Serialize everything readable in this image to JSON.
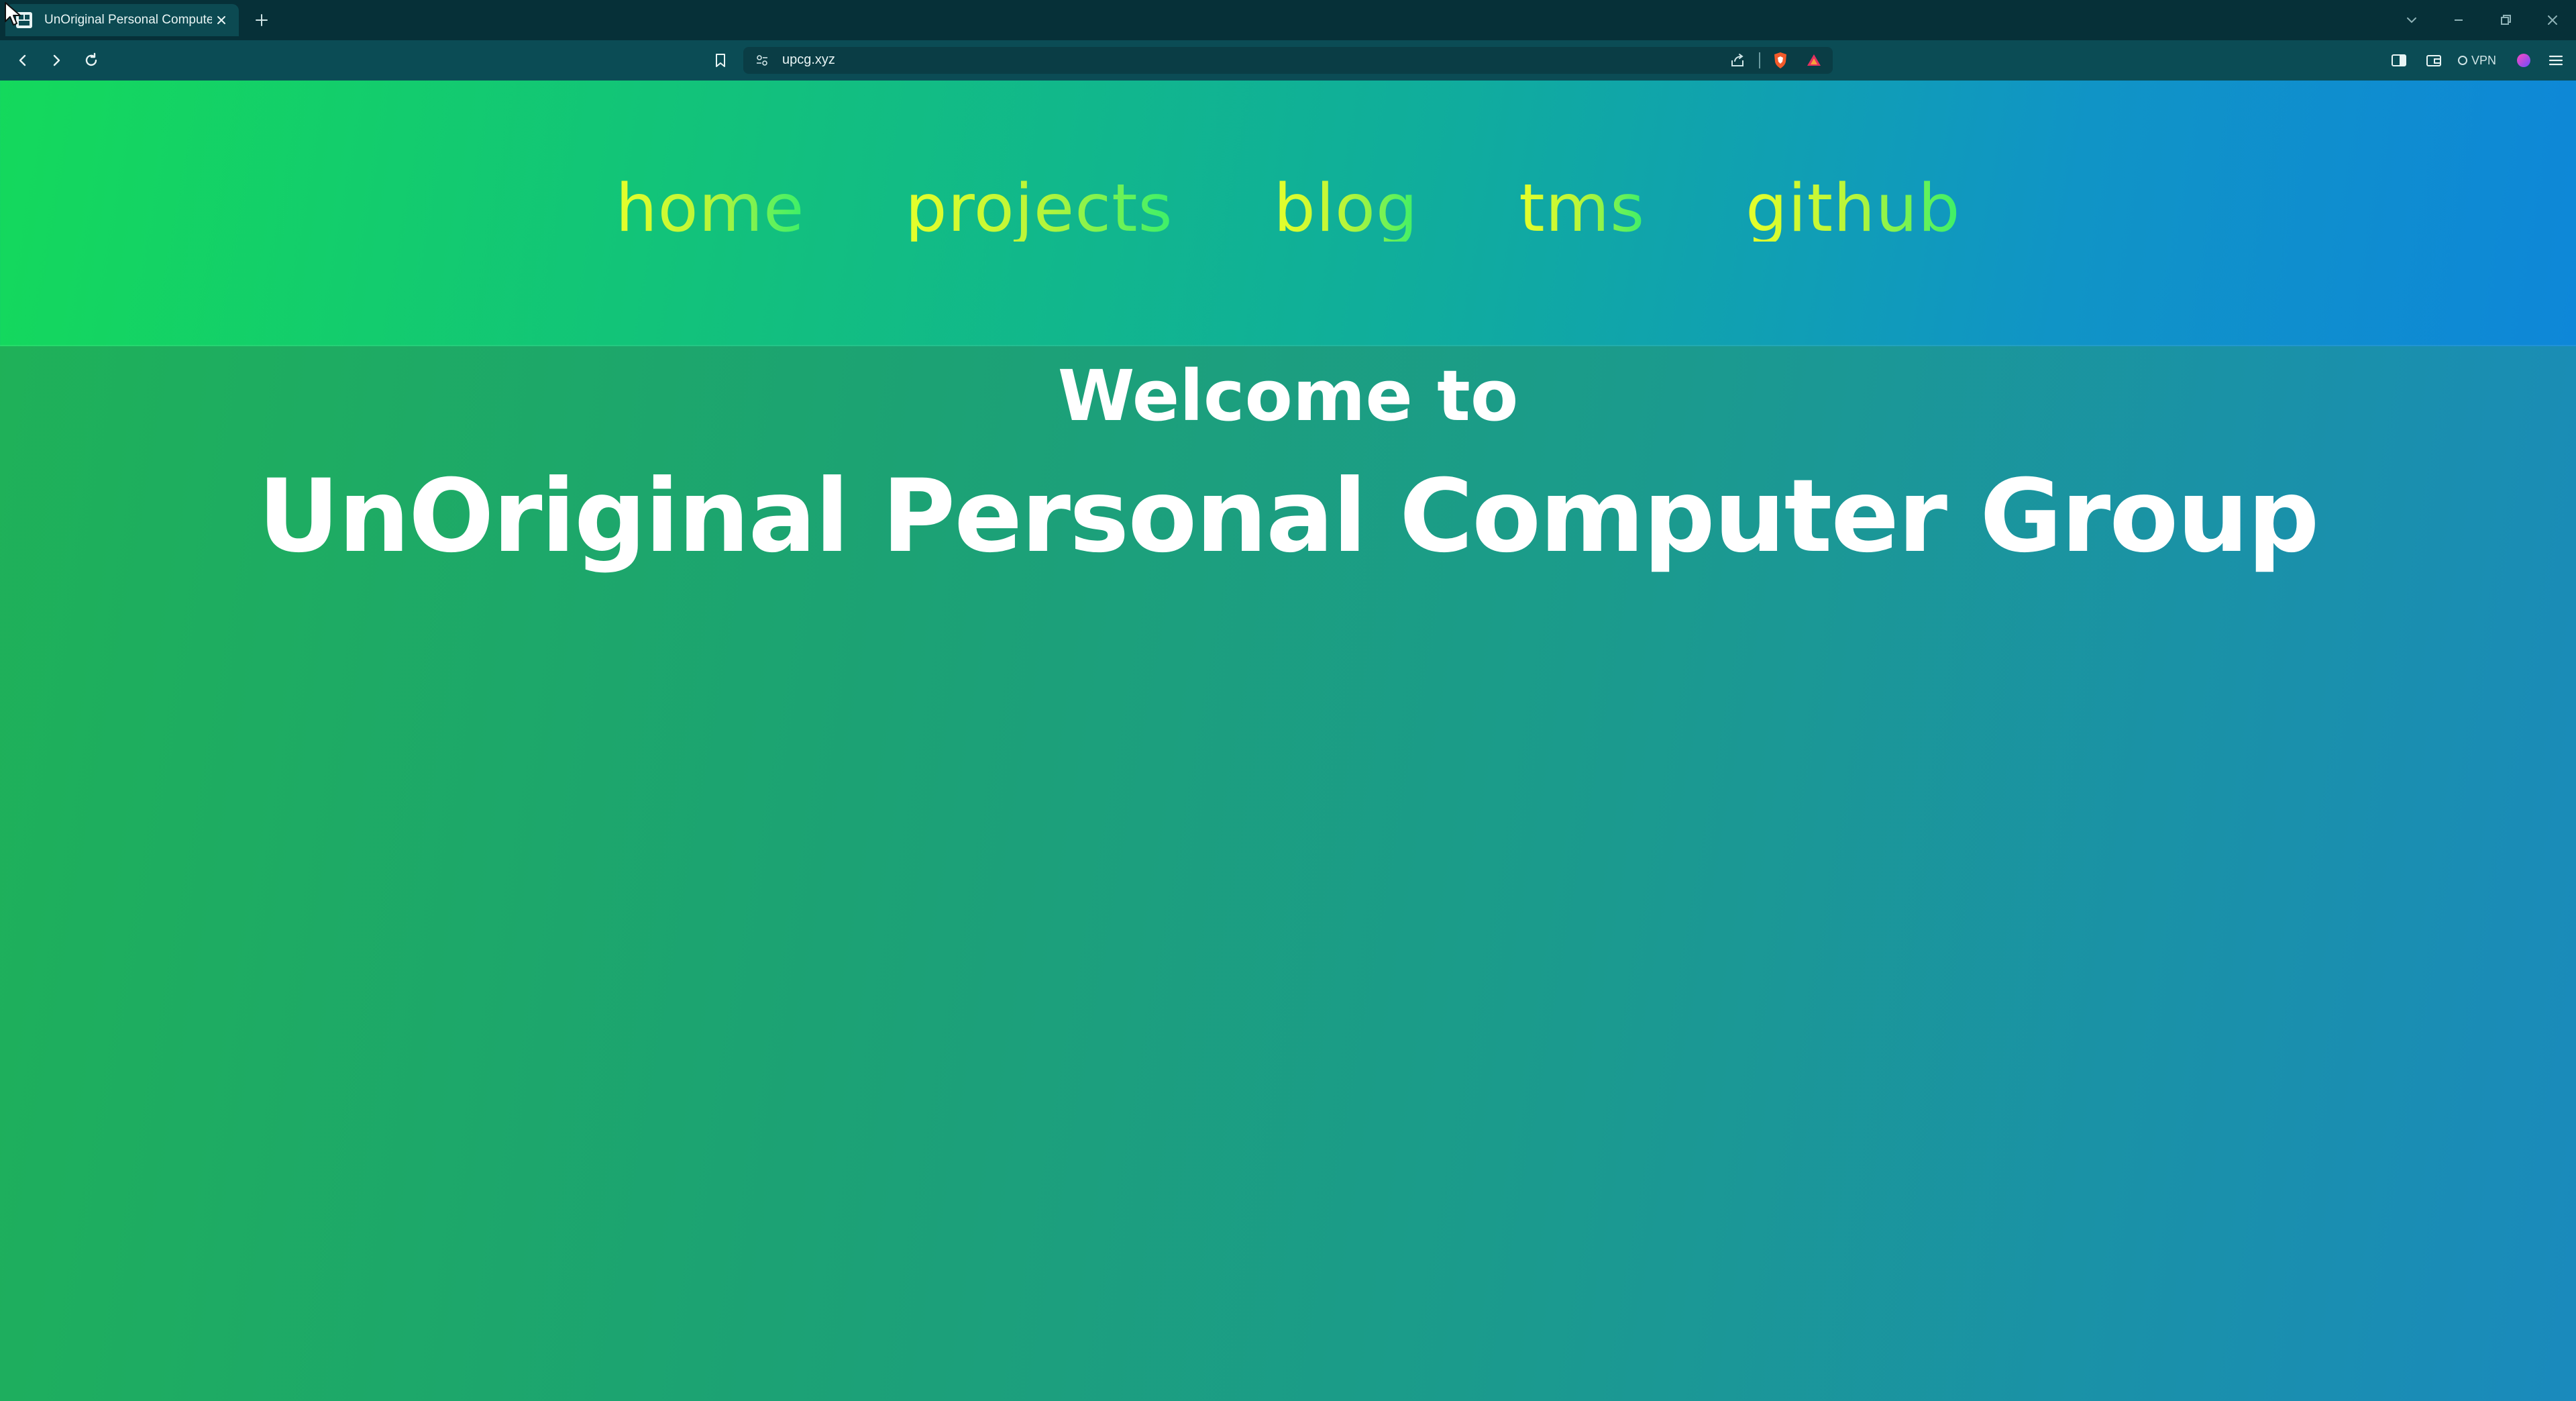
{
  "browser": {
    "tab": {
      "title": "UnOriginal Personal Computer",
      "close_icon": "close-icon",
      "favicon": "upcg-favicon"
    },
    "new_tab_icon": "plus-icon",
    "window_controls": [
      "chevron-down-icon",
      "minimize-icon",
      "restore-icon",
      "close-icon"
    ],
    "toolbar": {
      "back_icon": "back-arrow-icon",
      "forward_icon": "forward-arrow-icon",
      "reload_icon": "reload-icon",
      "bookmark_icon": "bookmark-icon",
      "url": "upcg.xyz",
      "site_info_icon": "site-settings-icon",
      "share_icon": "share-icon",
      "shields_icon": "brave-shields-icon",
      "rewards_icon": "brave-rewards-icon",
      "sidebar_icon": "sidebar-icon",
      "wallet_icon": "wallet-icon",
      "vpn_label": "VPN",
      "leo_icon": "leo-ai-icon",
      "menu_icon": "hamburger-menu-icon"
    }
  },
  "site": {
    "nav": [
      {
        "label": "home"
      },
      {
        "label": "projects"
      },
      {
        "label": "blog"
      },
      {
        "label": "tms"
      },
      {
        "label": "github"
      }
    ],
    "welcome": "Welcome to",
    "title": "UnOriginal Personal Computer Group"
  },
  "colors": {
    "tabbar_bg": "#063038",
    "toolbar_bg": "#0b4c55",
    "header_gradient_start": "#14d95c",
    "header_gradient_end": "#0e87d8",
    "page_gradient_start": "#1fb257",
    "page_gradient_end": "#1a8abd",
    "nav_gradient_start": "#e6ff2a",
    "nav_gradient_end": "#3bf06a",
    "heading_color": "#ffffff"
  }
}
